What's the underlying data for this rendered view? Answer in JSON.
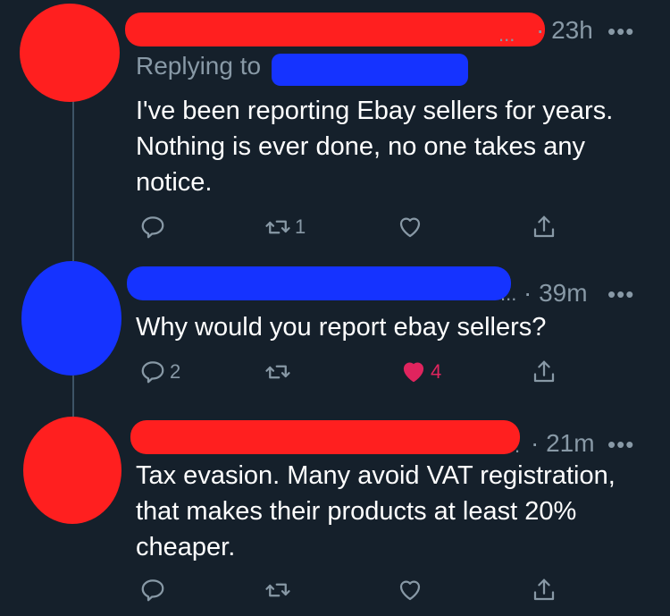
{
  "tweets": [
    {
      "time": "23h",
      "more": "•••",
      "trail": "...",
      "replying_label": "Replying to",
      "text": "I've been reporting Ebay sellers for years. Nothing is ever done, no one takes any notice.",
      "replies": "",
      "retweets": "1",
      "likes": ""
    },
    {
      "time": "39m",
      "more": "•••",
      "trail": "...",
      "text": "Why would you report ebay sellers?",
      "replies": "2",
      "retweets": "",
      "likes": "4",
      "liked": true
    },
    {
      "time": "21m",
      "more": "•••",
      "trail": ".",
      "text": "Tax evasion. Many avoid VAT registration, that makes their products at least 20% cheaper.",
      "replies": "",
      "retweets": "",
      "likes": ""
    }
  ],
  "colors": {
    "background": "#15202b",
    "secondary_text": "#8899a6",
    "like_active": "#e0245e",
    "redaction_red": "#ff1f1f",
    "redaction_blue": "#1533ff"
  },
  "icons": [
    "reply-icon",
    "retweet-icon",
    "like-icon",
    "share-icon",
    "more-icon"
  ]
}
